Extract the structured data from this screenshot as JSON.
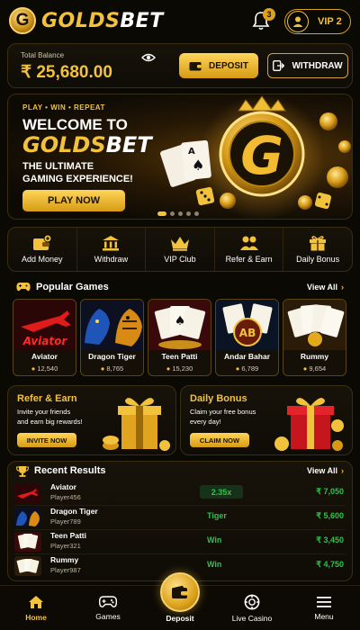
{
  "app": {
    "logo_letter": "G",
    "brand_gold": "GOLDS",
    "brand_white": "BET",
    "notification_count": "3",
    "vip_label": "VIP 2"
  },
  "balance": {
    "label": "Total Balance",
    "value": "₹ 25,680.00",
    "deposit_label": "DEPOSIT",
    "withdraw_label": "WITHDRAW"
  },
  "banner": {
    "tagline": "PLAY • WIN • REPEAT",
    "welcome": "WELCOME TO",
    "brand_gold": "GOLDS",
    "brand_white": "BET",
    "subtitle_line1": "THE ULTIMATE",
    "subtitle_line2": "GAMING EXPERIENCE!",
    "cta": "PLAY NOW",
    "active_slide": 1,
    "slide_count": 5
  },
  "quick_actions": [
    {
      "label": "Add Money",
      "icon": "wallet-plus-icon"
    },
    {
      "label": "Withdraw",
      "icon": "bank-icon"
    },
    {
      "label": "VIP Club",
      "icon": "crown-icon"
    },
    {
      "label": "Refer & Earn",
      "icon": "users-icon"
    },
    {
      "label": "Daily Bonus",
      "icon": "gift-icon"
    }
  ],
  "popular_games": {
    "title": "Popular Games",
    "view_all": "View All",
    "items": [
      {
        "name": "Aviator",
        "players": "12,540",
        "art_text": "Aviator"
      },
      {
        "name": "Dragon Tiger",
        "players": "8,765"
      },
      {
        "name": "Teen Patti",
        "players": "15,230"
      },
      {
        "name": "Andar Bahar",
        "players": "6,789",
        "art_text": "AB"
      },
      {
        "name": "Rummy",
        "players": "9,654"
      }
    ]
  },
  "promos": [
    {
      "title": "Refer & Earn",
      "line1": "Invite your friends",
      "line2": "and earn big rewards!",
      "button": "INVITE NOW"
    },
    {
      "title": "Daily Bonus",
      "line1": "Claim your free bonus",
      "line2": "every day!",
      "button": "CLAIM NOW"
    }
  ],
  "recent_results": {
    "title": "Recent Results",
    "view_all": "View All",
    "rows": [
      {
        "game": "Aviator",
        "player": "Player456",
        "status": "2.35x",
        "amount": "₹ 7,050"
      },
      {
        "game": "Dragon Tiger",
        "player": "Player789",
        "status": "Tiger",
        "amount": "₹ 5,600"
      },
      {
        "game": "Teen Patti",
        "player": "Player321",
        "status": "Win",
        "amount": "₹ 3,450"
      },
      {
        "game": "Rummy",
        "player": "Player987",
        "status": "Win",
        "amount": "₹ 4,750"
      }
    ]
  },
  "bottom_nav": {
    "home": "Home",
    "games": "Games",
    "deposit": "Deposit",
    "live_casino": "Live Casino",
    "menu": "Menu"
  },
  "colors": {
    "gold": "#f3c23c",
    "background": "#0b0904",
    "win_green": "#31c24a"
  }
}
